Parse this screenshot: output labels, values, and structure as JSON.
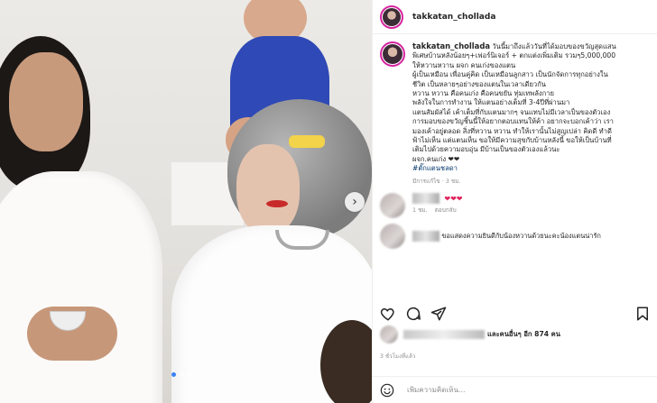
{
  "post": {
    "photo_alt": "",
    "carousel_dots": 4,
    "active_dot": 0
  },
  "header": {
    "username": "takkatan_chollada"
  },
  "caption": {
    "username": "takkatan_chollada",
    "lines": [
      "วันนี้มาถึงแล้ววันที่ได้มอบของขวัญสุดแสน",
      "พิเศษบ้านหลังน้อยๆ+เฟอร์นิเจอร์ + ตกแต่งเพิ่มเติม รวมๆ5,000,000",
      "ให้หวานหวาน ผจก คนเก่งของแตน",
      "ผู้เป็นเหมือน เพื่อนคู่คิด เป็นเหมือนลูกสาว เป็นนักจัดการทุกอย่างใน",
      "ชีวิต เป็นหลายๆอย่างของแตนในเวลาเดียวกัน",
      "หวาน หวาน คือคนเก่ง คือคนขยัน ทุ่มเทพลังกาย",
      "พลังใจในการทำงาน ให้แตนอย่างเต็มที่ 3-4ปีที่ผ่านมา",
      "แตนสัมผัสได้ เค้าเต็มที่กับแตนมากๆ จนแทบไม่มีเวลาเป็นของตัวเอง",
      "การมอบของขวัญชิ้นนี้ให้อยากตอบแทนให้ค้า อยากจะบอกเค้าว่า เรา",
      "มองเค้าอยู่ตลอด สิ่งที่หวาน หวาน ทำให้เรานั้นไม่สูญเปล่า คิดดี ทำดี",
      "ฟ้าไม่เห็น แต่แตนเห็น ขอให้มีความสุขกับบ้านหลังนี้ ขอให้เป็นบ้านที่",
      "เติมไปด้วยความอบอุ่น มีบ้านเป็นของตัวเองแล้วนะ",
      "ผจก.คนเก่ง ❤❤"
    ],
    "hashtag": "#ตั๊กแตนชลดา",
    "meta": "มีการแก้ไข · 3 ชม."
  },
  "comments": [
    {
      "text": "❤❤❤",
      "time": "1 ชม.",
      "reply": "ตอบกลับ"
    },
    {
      "text": "ขอแสดงความยินดีกับน้องหวานด้วยนะคะน้องแตนน่ารัก"
    }
  ],
  "likes": {
    "text": "และคนอื่นๆ อีก 874 คน"
  },
  "time_ago": "3 ชั่วโมงที่แล้ว",
  "add_comment": {
    "placeholder": "เพิ่มความคิดเห็น..."
  },
  "icons": [
    "heart-icon",
    "comment-icon",
    "share-icon",
    "save-icon",
    "emoji-icon",
    "chevron-right-icon"
  ]
}
